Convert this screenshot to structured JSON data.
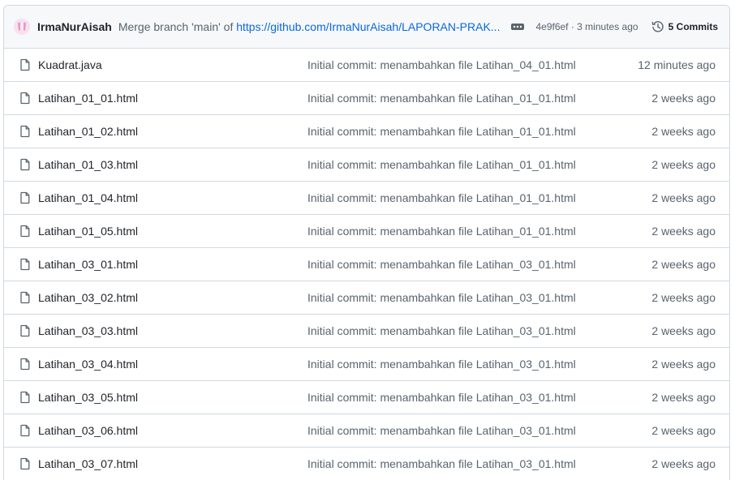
{
  "latest_commit": {
    "author": "IrmaNurAisah",
    "message_prefix": "Merge branch 'main' of ",
    "message_link": "https://github.com/IrmaNurAisah/LAPORAN-PRAK...",
    "sha_time": "4e9f6ef · 3 minutes ago",
    "commits_label": "5 Commits",
    "icons": {
      "avatar": "user-avatar",
      "more": "kebab-horizontal-icon",
      "history": "history-icon"
    }
  },
  "files": [
    {
      "name": "Kuadrat.java",
      "commit": "Initial commit: menambahkan file Latihan_04_01.html",
      "age": "12 minutes ago",
      "icon": "file-icon"
    },
    {
      "name": "Latihan_01_01.html",
      "commit": "Initial commit: menambahkan file Latihan_01_01.html",
      "age": "2 weeks ago",
      "icon": "file-icon"
    },
    {
      "name": "Latihan_01_02.html",
      "commit": "Initial commit: menambahkan file Latihan_01_01.html",
      "age": "2 weeks ago",
      "icon": "file-icon"
    },
    {
      "name": "Latihan_01_03.html",
      "commit": "Initial commit: menambahkan file Latihan_01_01.html",
      "age": "2 weeks ago",
      "icon": "file-icon"
    },
    {
      "name": "Latihan_01_04.html",
      "commit": "Initial commit: menambahkan file Latihan_01_01.html",
      "age": "2 weeks ago",
      "icon": "file-icon"
    },
    {
      "name": "Latihan_01_05.html",
      "commit": "Initial commit: menambahkan file Latihan_01_01.html",
      "age": "2 weeks ago",
      "icon": "file-icon"
    },
    {
      "name": "Latihan_03_01.html",
      "commit": "Initial commit: menambahkan file Latihan_03_01.html",
      "age": "2 weeks ago",
      "icon": "file-icon"
    },
    {
      "name": "Latihan_03_02.html",
      "commit": "Initial commit: menambahkan file Latihan_03_01.html",
      "age": "2 weeks ago",
      "icon": "file-icon"
    },
    {
      "name": "Latihan_03_03.html",
      "commit": "Initial commit: menambahkan file Latihan_03_01.html",
      "age": "2 weeks ago",
      "icon": "file-icon"
    },
    {
      "name": "Latihan_03_04.html",
      "commit": "Initial commit: menambahkan file Latihan_03_01.html",
      "age": "2 weeks ago",
      "icon": "file-icon"
    },
    {
      "name": "Latihan_03_05.html",
      "commit": "Initial commit: menambahkan file Latihan_03_01.html",
      "age": "2 weeks ago",
      "icon": "file-icon"
    },
    {
      "name": "Latihan_03_06.html",
      "commit": "Initial commit: menambahkan file Latihan_03_01.html",
      "age": "2 weeks ago",
      "icon": "file-icon"
    },
    {
      "name": "Latihan_03_07.html",
      "commit": "Initial commit: menambahkan file Latihan_03_01.html",
      "age": "2 weeks ago",
      "icon": "file-icon"
    }
  ],
  "colors": {
    "link": "#0969da",
    "muted": "#59636e",
    "border": "#d1d9e0",
    "header_bg": "#f6f8fa"
  }
}
